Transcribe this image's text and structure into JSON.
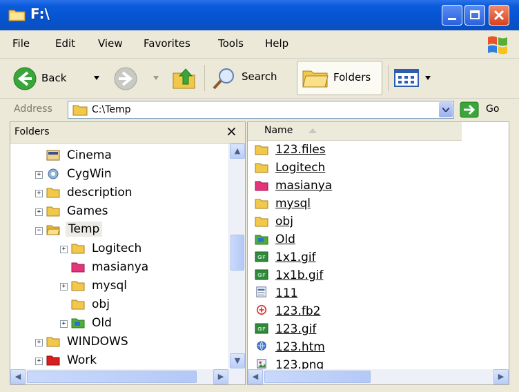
{
  "window": {
    "title": "F:\\",
    "accent": "#0a5bdb"
  },
  "menu": {
    "items": [
      "File",
      "Edit",
      "View",
      "Favorites",
      "Tools",
      "Help"
    ]
  },
  "toolbar": {
    "back_label": "Back",
    "search_label": "Search",
    "folders_label": "Folders"
  },
  "address": {
    "label": "Address",
    "value": "C:\\Temp",
    "go_label": "Go"
  },
  "folders_pane": {
    "title": "Folders",
    "close_glyph": "×",
    "items": [
      {
        "label": "Cinema",
        "icon": "cinema-folder-icon",
        "expander": ""
      },
      {
        "label": "CygWin",
        "icon": "cygwin-folder-icon",
        "expander": "+"
      },
      {
        "label": "description",
        "icon": "folder-icon",
        "expander": "+"
      },
      {
        "label": "Games",
        "icon": "folder-icon",
        "expander": "+"
      },
      {
        "label": "Temp",
        "icon": "folder-open-icon",
        "expander": "−",
        "selected": true
      },
      {
        "label": "Logitech",
        "icon": "folder-icon",
        "expander": "+"
      },
      {
        "label": "masianya",
        "icon": "pink-folder-icon",
        "expander": ""
      },
      {
        "label": "mysql",
        "icon": "folder-icon",
        "expander": "+"
      },
      {
        "label": "obj",
        "icon": "folder-icon",
        "expander": ""
      },
      {
        "label": "Old",
        "icon": "green-folder-icon",
        "expander": "+"
      },
      {
        "label": "WINDOWS",
        "icon": "folder-icon",
        "expander": "+"
      },
      {
        "label": "Work",
        "icon": "red-folder-icon",
        "expander": "+"
      }
    ]
  },
  "files_pane": {
    "column_name": "Name",
    "items": [
      {
        "label": "123.files",
        "icon": "folder-icon"
      },
      {
        "label": "Logitech",
        "icon": "folder-icon"
      },
      {
        "label": "masianya",
        "icon": "pink-folder-icon"
      },
      {
        "label": "mysql",
        "icon": "folder-icon"
      },
      {
        "label": "obj",
        "icon": "folder-icon"
      },
      {
        "label": "Old",
        "icon": "green-folder-icon"
      },
      {
        "label": "1x1.gif",
        "icon": "gif-image-icon"
      },
      {
        "label": "1x1b.gif",
        "icon": "gif-image-icon"
      },
      {
        "label": "111",
        "icon": "generic-file-icon"
      },
      {
        "label": "123.fb2",
        "icon": "fb2-file-icon"
      },
      {
        "label": "123.gif",
        "icon": "gif-image-icon"
      },
      {
        "label": "123.htm",
        "icon": "html-file-icon"
      },
      {
        "label": "123.png",
        "icon": "png-image-icon"
      }
    ]
  }
}
